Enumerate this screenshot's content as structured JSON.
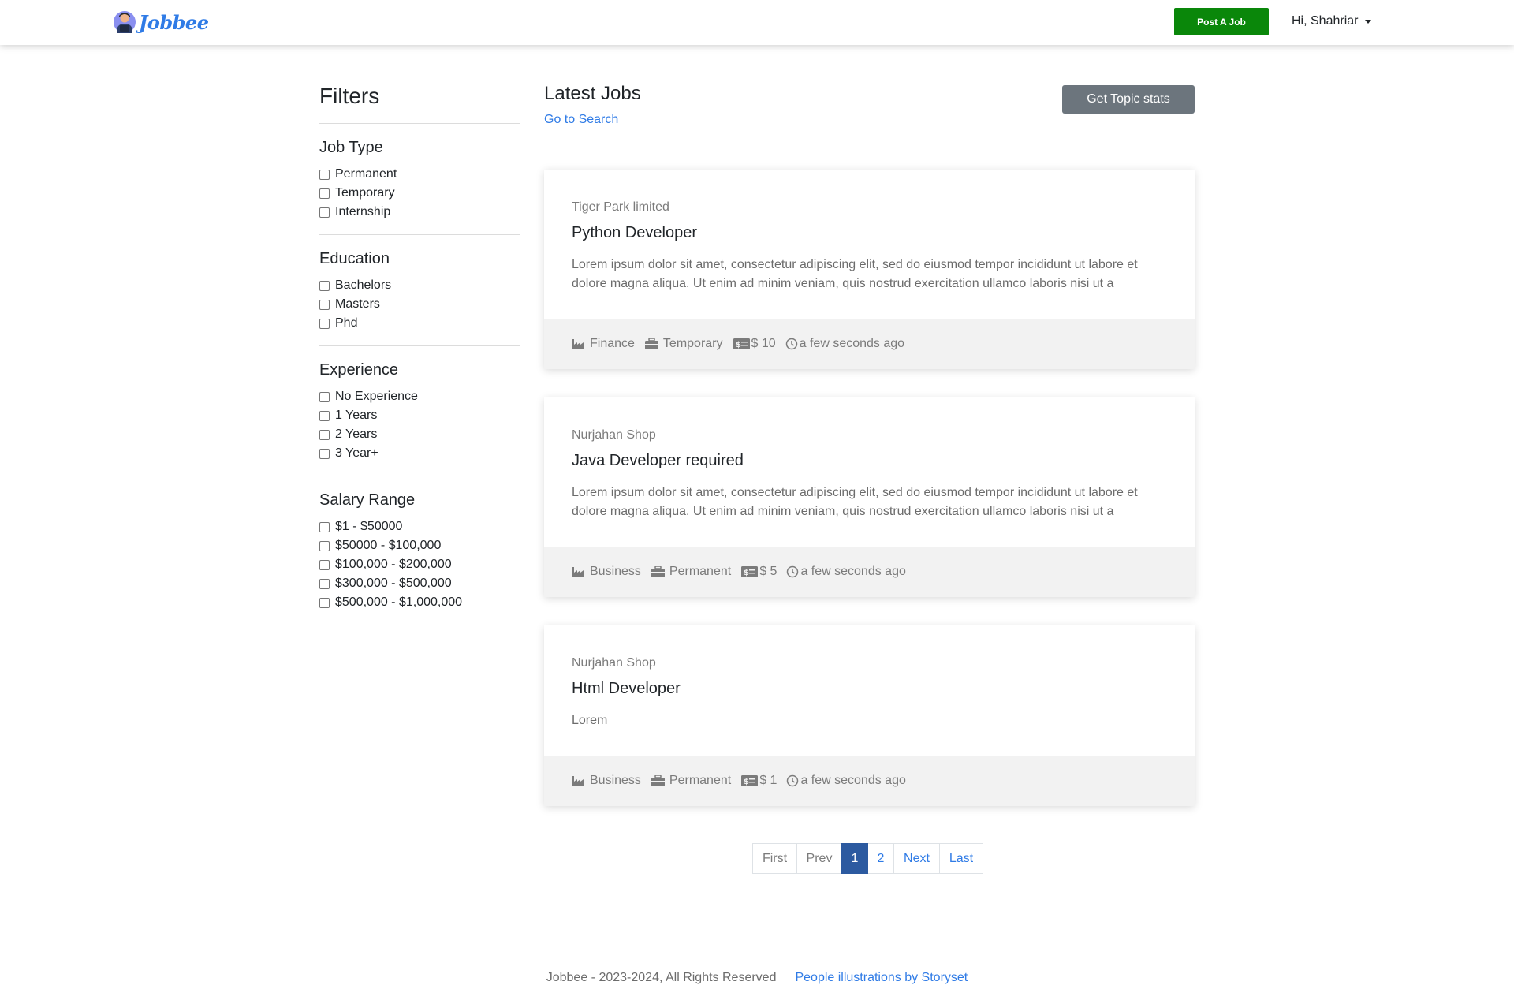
{
  "navbar": {
    "brand_text": "Jobbee",
    "post_job_label": "Post A Job",
    "user_greeting": "Hi, Shahriar"
  },
  "sidebar": {
    "title": "Filters",
    "groups": [
      {
        "title": "Job Type",
        "options": [
          "Permanent",
          "Temporary",
          "Internship"
        ]
      },
      {
        "title": "Education",
        "options": [
          "Bachelors",
          "Masters",
          "Phd"
        ]
      },
      {
        "title": "Experience",
        "options": [
          "No Experience",
          "1 Years",
          "2 Years",
          "3 Year+"
        ]
      },
      {
        "title": "Salary Range",
        "options": [
          "$1 - $50000",
          "$50000 - $100,000",
          "$100,000 - $200,000",
          "$300,000 - $500,000",
          "$500,000 - $1,000,000"
        ]
      }
    ]
  },
  "main": {
    "title": "Latest Jobs",
    "search_link": "Go to Search",
    "topic_stats_label": "Get Topic stats",
    "jobs": [
      {
        "company": "Tiger Park limited",
        "title": "Python Developer",
        "description": "Lorem ipsum dolor sit amet, consectetur adipiscing elit, sed do eiusmod tempor incididunt ut labore et dolore magna aliqua. Ut enim ad minim veniam, quis nostrud exercitation ullamco laboris nisi ut a",
        "industry": "Finance",
        "job_type": "Temporary",
        "salary": "$ 10",
        "posted": "a few seconds ago"
      },
      {
        "company": "Nurjahan Shop",
        "title": "Java Developer required",
        "description": "Lorem ipsum dolor sit amet, consectetur adipiscing elit, sed do eiusmod tempor incididunt ut labore et dolore magna aliqua. Ut enim ad minim veniam, quis nostrud exercitation ullamco laboris nisi ut a",
        "industry": "Business",
        "job_type": "Permanent",
        "salary": "$ 5",
        "posted": "a few seconds ago"
      },
      {
        "company": "Nurjahan Shop",
        "title": "Html Developer",
        "description": "Lorem",
        "industry": "Business",
        "job_type": "Permanent",
        "salary": "$ 1",
        "posted": "a few seconds ago"
      }
    ]
  },
  "pagination": {
    "first": "First",
    "prev": "Prev",
    "pages": [
      "1",
      "2"
    ],
    "active_page": "1",
    "next": "Next",
    "last": "Last"
  },
  "footer": {
    "copyright": "Jobbee - 2023-2024, All Rights Reserved",
    "credit_link": "People illustrations by Storyset"
  },
  "colors": {
    "accent": "#2f7be6",
    "post_button": "#0a870a",
    "topic_button": "#6c757d",
    "active_page": "#2c5aa0"
  }
}
